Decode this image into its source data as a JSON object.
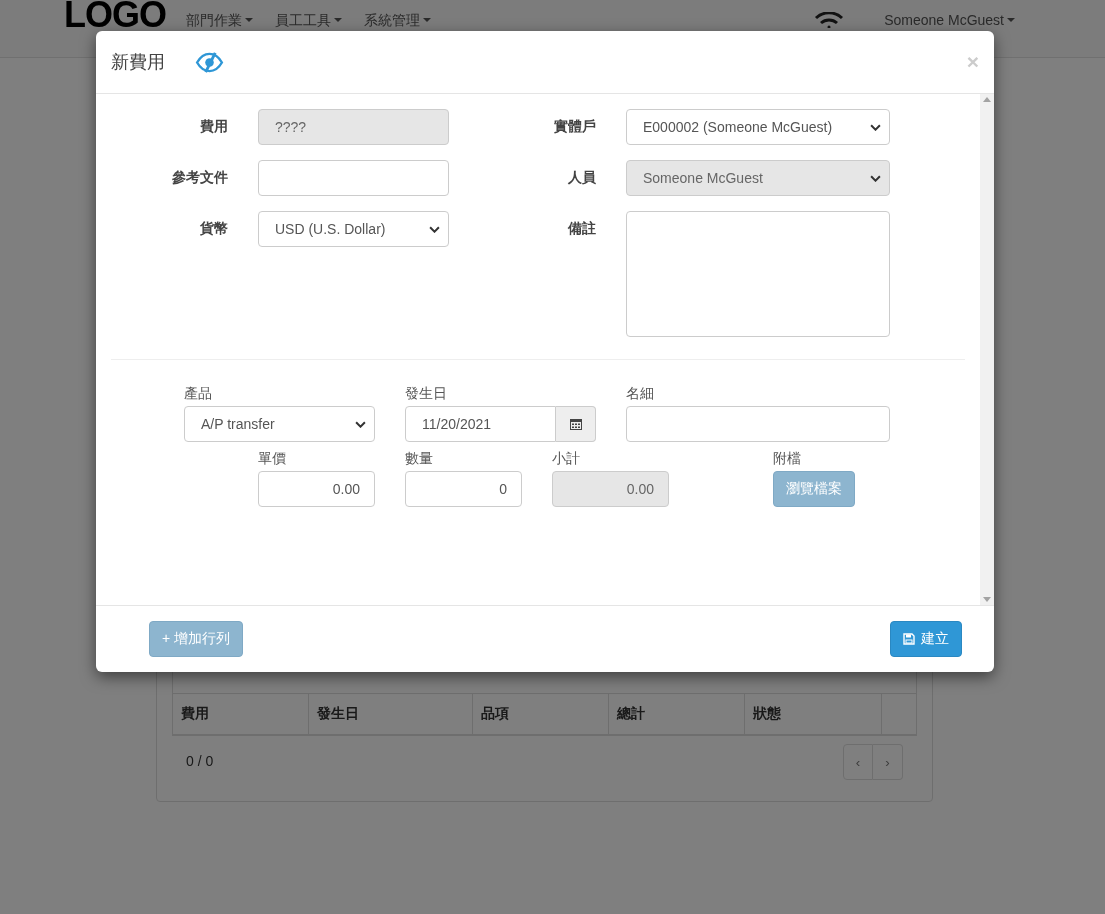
{
  "navbar": {
    "logo": "LOGO",
    "menus": [
      "部門作業",
      "員工工具",
      "系統管理"
    ],
    "user": "Someone McGuest"
  },
  "background_table": {
    "columns": [
      "費用",
      "發生日",
      "品項",
      "總計",
      "狀態"
    ],
    "count": "0 / 0",
    "pager": [
      "‹",
      "›"
    ]
  },
  "modal": {
    "title": "新費用",
    "close": "×",
    "fields_left": [
      {
        "label": "費用",
        "kind": "text",
        "value": "????",
        "disabled": true
      },
      {
        "label": "參考文件",
        "kind": "text",
        "disabled": false
      },
      {
        "label": "貨幣",
        "kind": "select",
        "value": "USD (U.S. Dollar)",
        "disabled": false
      }
    ],
    "fields_right": [
      {
        "label": "實體戶",
        "kind": "select",
        "value": "E000002 (Someone McGuest)",
        "disabled": false
      },
      {
        "label": "人員",
        "kind": "select",
        "value": "Someone McGuest",
        "disabled": true
      },
      {
        "label": "備註",
        "kind": "textarea",
        "disabled": false
      }
    ],
    "line_row_1": [
      {
        "label": "產品",
        "kind": "select",
        "value": "A/P transfer",
        "disabled": false
      },
      {
        "label": "發生日",
        "kind": "date",
        "value": "11/20/2021",
        "disabled": false
      },
      {
        "label": "名細",
        "kind": "text",
        "disabled": false
      }
    ],
    "line_row_2": [
      {
        "label": "單價",
        "kind": "number",
        "value": "0.00",
        "disabled": false
      },
      {
        "label": "數量",
        "kind": "number",
        "value": "0",
        "disabled": false
      },
      {
        "label": "小計",
        "kind": "number",
        "value": "0.00",
        "disabled": true
      },
      {
        "label": "附檔",
        "kind": "file",
        "button": "瀏覽檔案",
        "disabled": true
      }
    ],
    "add_row_button": {
      "label": "+ 增加行列",
      "disabled": true
    },
    "create_button": {
      "label": "建立",
      "disabled": false
    }
  }
}
